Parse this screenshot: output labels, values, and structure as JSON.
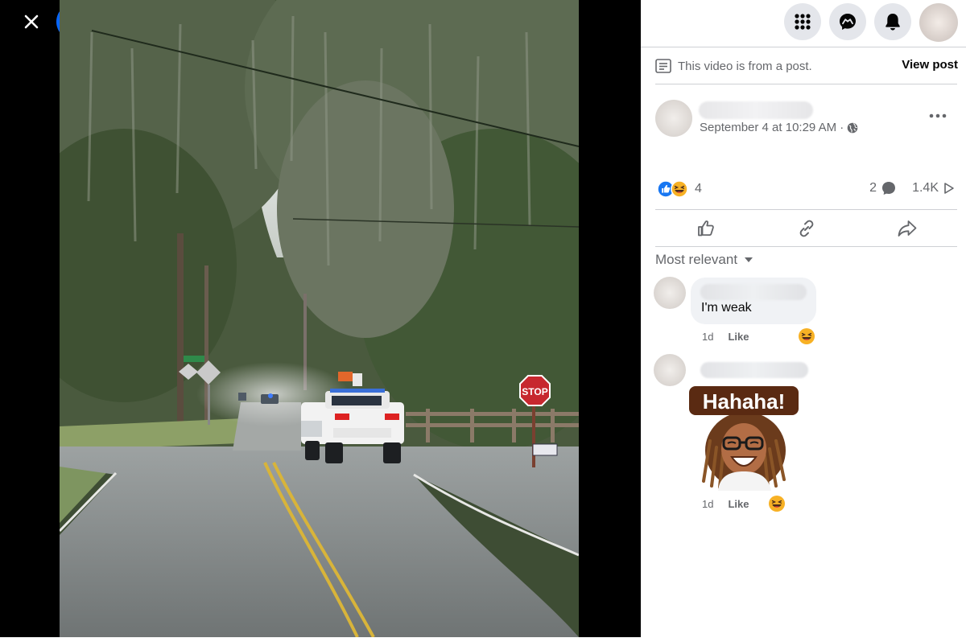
{
  "viewer": {
    "close_icon": "close-icon",
    "logo_icon": "facebook-logo-icon"
  },
  "nav": {
    "menu_icon": "grid-menu-icon",
    "messenger_icon": "messenger-icon",
    "notifications_icon": "bell-icon"
  },
  "notice": {
    "icon": "post-icon",
    "text": "This video is from a post.",
    "view_post": "View post"
  },
  "post": {
    "timestamp": "September 4 at 10:29 AM ·",
    "audience_icon": "globe-icon",
    "reaction_count": "4",
    "comment_count": "2",
    "view_count": "1.4K"
  },
  "comment_sort": "Most relevant",
  "comments": [
    {
      "text": "I'm weak",
      "time": "1d",
      "like_label": "Like"
    },
    {
      "sticker_text": "Hahaha!",
      "time": "1d",
      "like_label": "Like"
    }
  ],
  "colors": {
    "facebook_blue": "#0866ff",
    "secondary_text": "#65676b",
    "nav_button_bg": "#e4e6eb",
    "comment_bubble": "#f0f2f5"
  }
}
